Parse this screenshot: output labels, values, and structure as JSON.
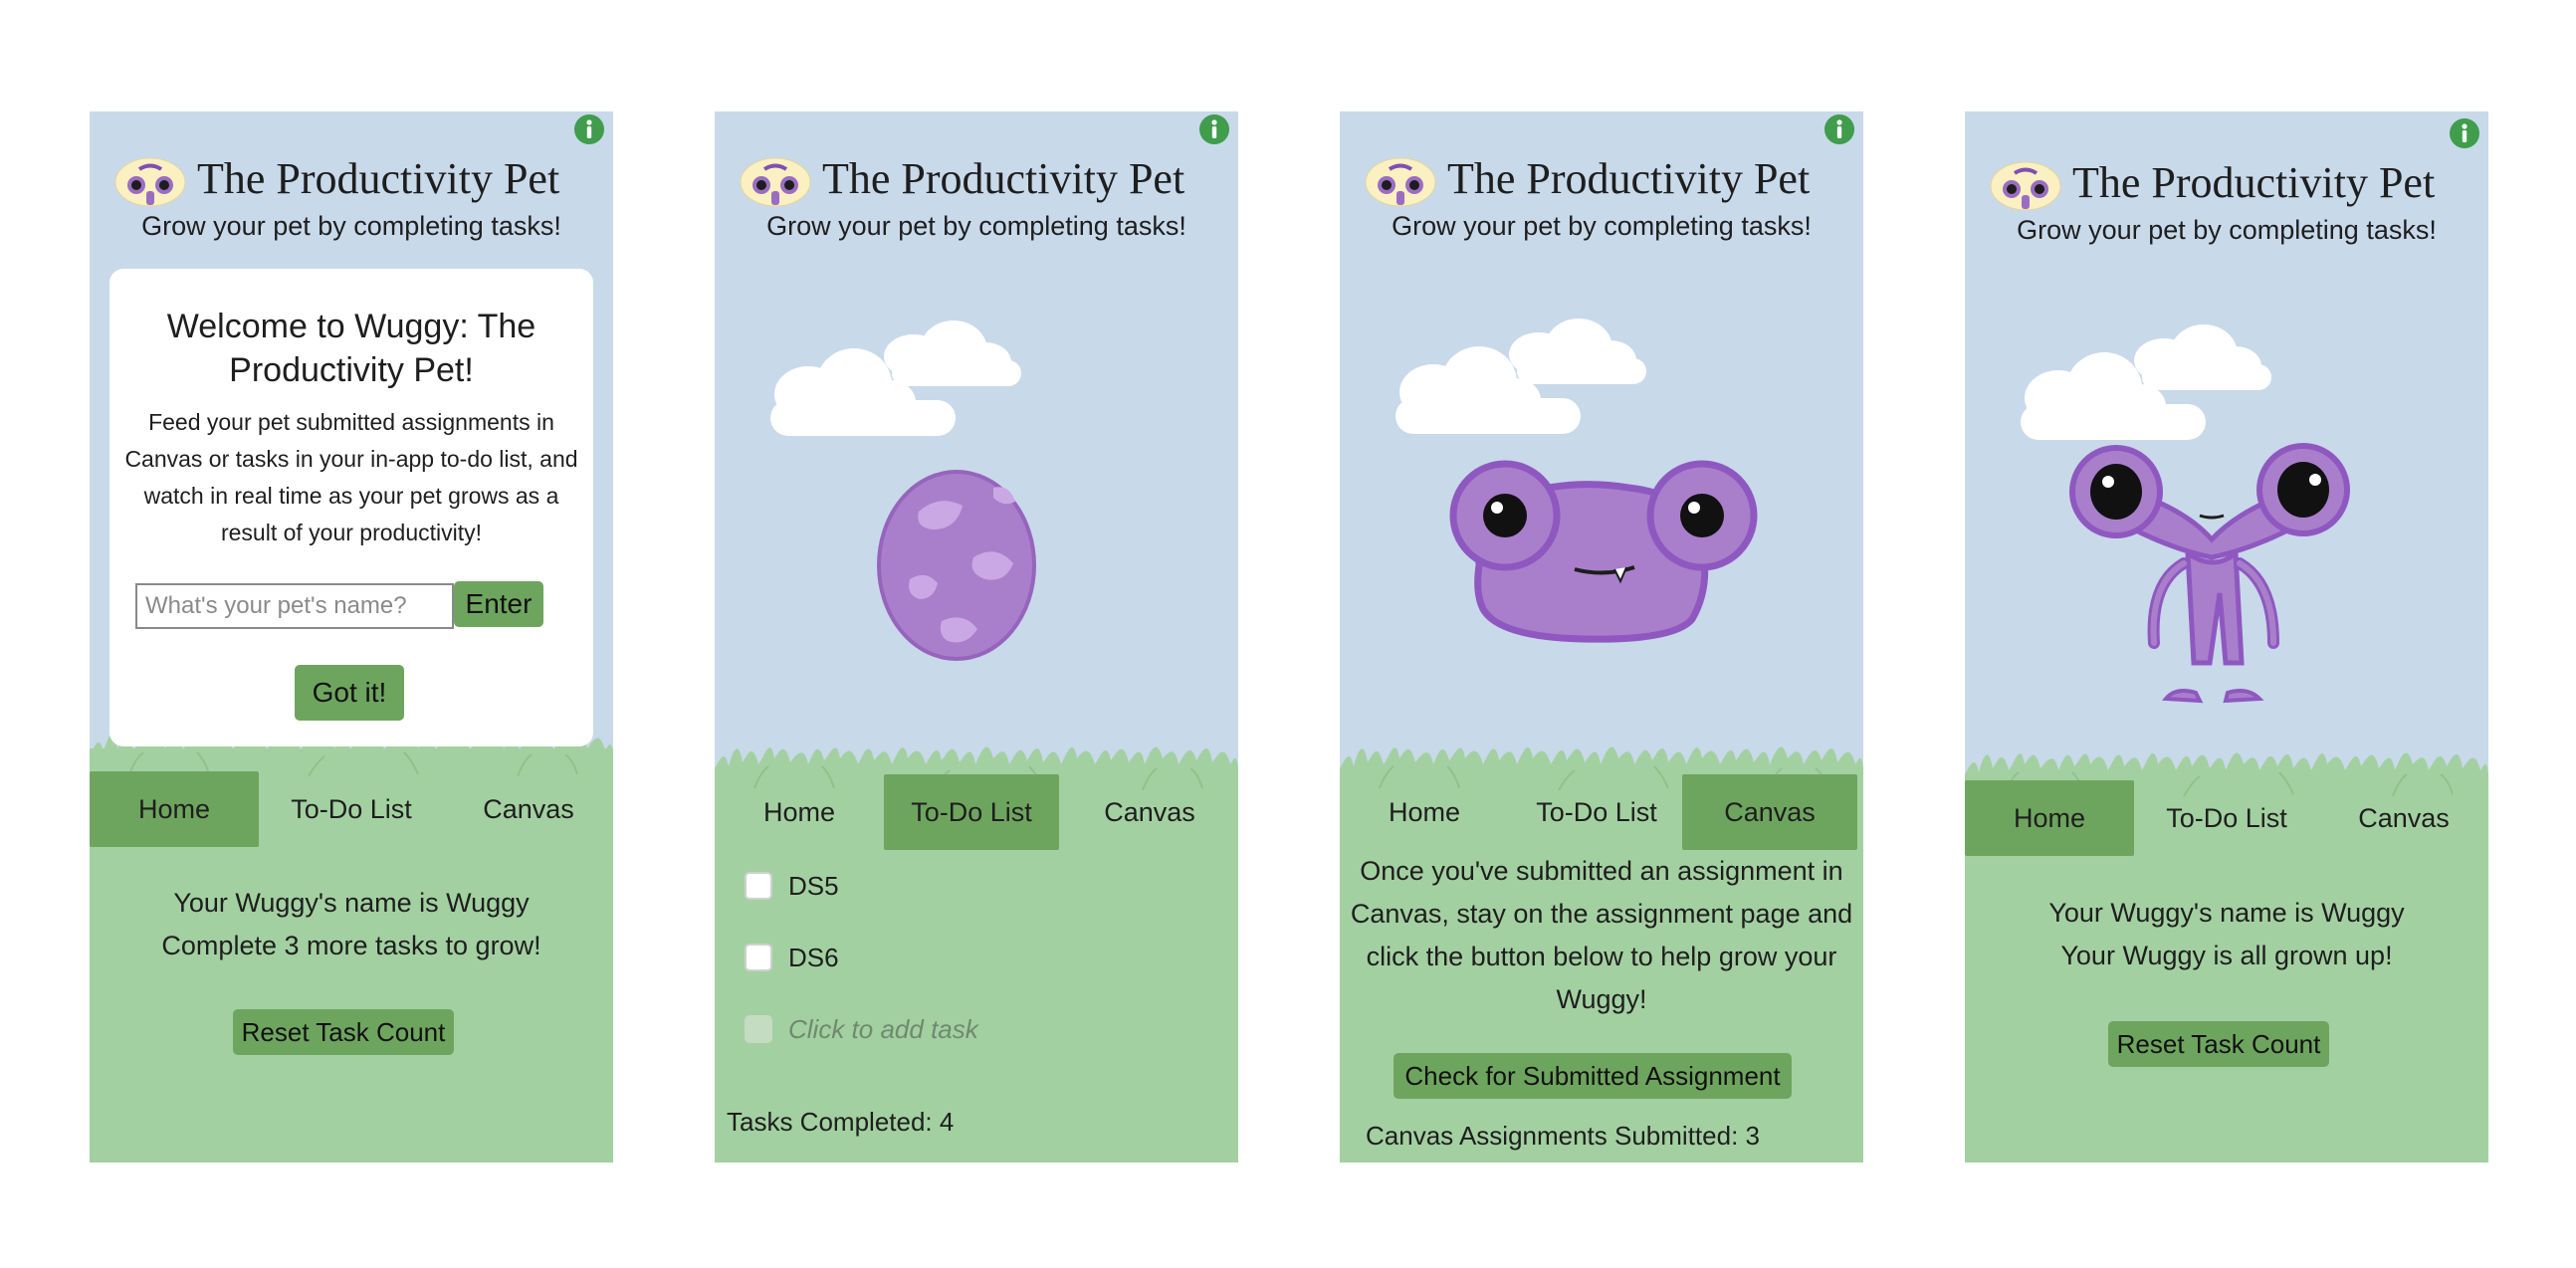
{
  "app": {
    "title": "The Productivity Pet",
    "tagline": "Grow your pet by completing tasks!",
    "logo_text": "Wuggy"
  },
  "nav": {
    "home": "Home",
    "todo": "To-Do List",
    "canvas": "Canvas"
  },
  "colors": {
    "sky": "#c8d9ea",
    "ground": "#a3d0a1",
    "accent": "#6ea55e",
    "pet": "#a97fcb",
    "info": "#3f9d4b"
  },
  "screens": [
    {
      "active_tab": "Home",
      "welcome": {
        "title": "Welcome to Wuggy: The Productivity Pet!",
        "body": "Feed your pet submitted assignments in Canvas or tasks in your in-app to-do list, and watch in real time as your pet grows as a result of your productivity!",
        "name_placeholder": "What's your pet's name?",
        "enter_label": "Enter",
        "got_it_label": "Got it!"
      },
      "status_line1": "Your Wuggy's name is Wuggy",
      "status_line2": "Complete 3 more tasks to grow!",
      "reset_label": "Reset Task Count"
    },
    {
      "active_tab": "To-Do List",
      "pet_stage": "egg",
      "tasks": [
        {
          "label": "DS5",
          "checked": false
        },
        {
          "label": "DS6",
          "checked": false
        }
      ],
      "add_task_placeholder": "Click to add task",
      "tasks_completed": "Tasks Completed: 4"
    },
    {
      "active_tab": "Canvas",
      "pet_stage": "baby",
      "instructions": "Once you've submitted an assignment in Canvas, stay on the assignment page and click the button below to help grow your Wuggy!",
      "check_label": "Check for Submitted Assignment",
      "submitted_count": "Canvas Assignments Submitted: 3"
    },
    {
      "active_tab": "Home",
      "pet_stage": "adult",
      "status_line1": "Your Wuggy's name is Wuggy",
      "status_line2": "Your Wuggy is all grown up!",
      "reset_label": "Reset Task Count"
    }
  ]
}
